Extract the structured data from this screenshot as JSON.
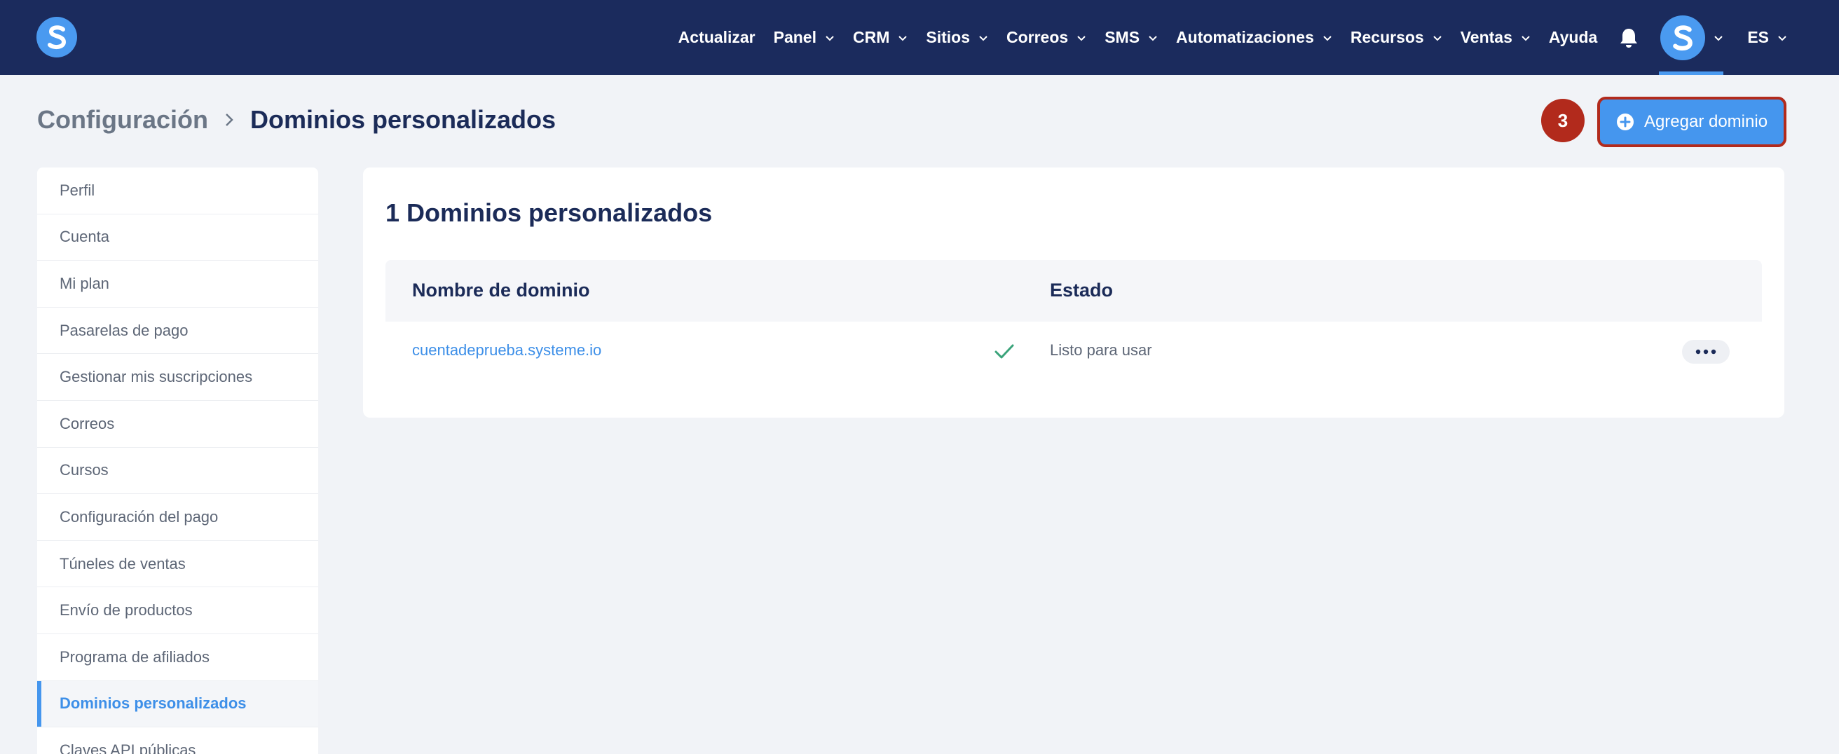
{
  "nav": {
    "items": [
      {
        "label": "Actualizar",
        "dropdown": false
      },
      {
        "label": "Panel",
        "dropdown": true
      },
      {
        "label": "CRM",
        "dropdown": true
      },
      {
        "label": "Sitios",
        "dropdown": true
      },
      {
        "label": "Correos",
        "dropdown": true
      },
      {
        "label": "SMS",
        "dropdown": true
      },
      {
        "label": "Automatizaciones",
        "dropdown": true
      },
      {
        "label": "Recursos",
        "dropdown": true
      },
      {
        "label": "Ventas",
        "dropdown": true
      },
      {
        "label": "Ayuda",
        "dropdown": false
      }
    ],
    "language": "ES"
  },
  "header": {
    "breadcrumb_root": "Configuración",
    "breadcrumb_current": "Dominios personalizados",
    "step_badge": "3",
    "add_button_label": "Agregar dominio"
  },
  "sidebar": {
    "items": [
      {
        "label": "Perfil"
      },
      {
        "label": "Cuenta"
      },
      {
        "label": "Mi plan"
      },
      {
        "label": "Pasarelas de pago"
      },
      {
        "label": "Gestionar mis suscripciones"
      },
      {
        "label": "Correos"
      },
      {
        "label": "Cursos"
      },
      {
        "label": "Configuración del pago"
      },
      {
        "label": "Túneles de ventas"
      },
      {
        "label": "Envío de productos"
      },
      {
        "label": "Programa de afiliados"
      },
      {
        "label": "Dominios personalizados",
        "active": true
      },
      {
        "label": "Claves API públicas"
      }
    ]
  },
  "main": {
    "card_title": "1 Dominios personalizados",
    "columns": {
      "domain": "Nombre de dominio",
      "status": "Estado"
    },
    "rows": [
      {
        "domain": "cuentadeprueba.systeme.io",
        "status": "Listo para usar",
        "status_icon": "check-icon"
      }
    ]
  },
  "colors": {
    "nav_bg": "#1b2b5d",
    "accent": "#4596ee",
    "badge": "#b22a1c",
    "success": "#3aa37a"
  }
}
